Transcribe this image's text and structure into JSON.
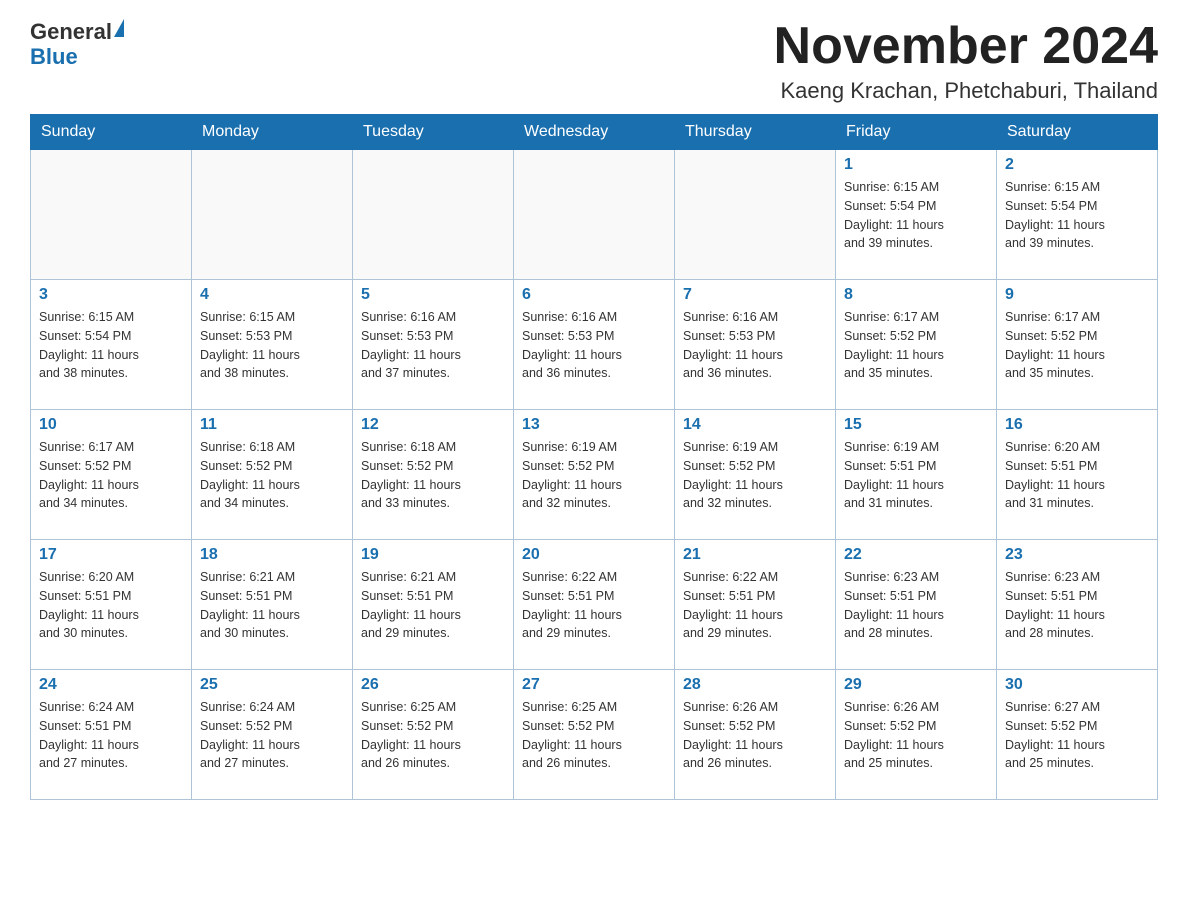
{
  "header": {
    "logo": {
      "line1": "General",
      "line2": "Blue"
    },
    "month_title": "November 2024",
    "location": "Kaeng Krachan, Phetchaburi, Thailand"
  },
  "days_of_week": [
    "Sunday",
    "Monday",
    "Tuesday",
    "Wednesday",
    "Thursday",
    "Friday",
    "Saturday"
  ],
  "weeks": [
    {
      "days": [
        {
          "number": "",
          "info": ""
        },
        {
          "number": "",
          "info": ""
        },
        {
          "number": "",
          "info": ""
        },
        {
          "number": "",
          "info": ""
        },
        {
          "number": "",
          "info": ""
        },
        {
          "number": "1",
          "info": "Sunrise: 6:15 AM\nSunset: 5:54 PM\nDaylight: 11 hours\nand 39 minutes."
        },
        {
          "number": "2",
          "info": "Sunrise: 6:15 AM\nSunset: 5:54 PM\nDaylight: 11 hours\nand 39 minutes."
        }
      ]
    },
    {
      "days": [
        {
          "number": "3",
          "info": "Sunrise: 6:15 AM\nSunset: 5:54 PM\nDaylight: 11 hours\nand 38 minutes."
        },
        {
          "number": "4",
          "info": "Sunrise: 6:15 AM\nSunset: 5:53 PM\nDaylight: 11 hours\nand 38 minutes."
        },
        {
          "number": "5",
          "info": "Sunrise: 6:16 AM\nSunset: 5:53 PM\nDaylight: 11 hours\nand 37 minutes."
        },
        {
          "number": "6",
          "info": "Sunrise: 6:16 AM\nSunset: 5:53 PM\nDaylight: 11 hours\nand 36 minutes."
        },
        {
          "number": "7",
          "info": "Sunrise: 6:16 AM\nSunset: 5:53 PM\nDaylight: 11 hours\nand 36 minutes."
        },
        {
          "number": "8",
          "info": "Sunrise: 6:17 AM\nSunset: 5:52 PM\nDaylight: 11 hours\nand 35 minutes."
        },
        {
          "number": "9",
          "info": "Sunrise: 6:17 AM\nSunset: 5:52 PM\nDaylight: 11 hours\nand 35 minutes."
        }
      ]
    },
    {
      "days": [
        {
          "number": "10",
          "info": "Sunrise: 6:17 AM\nSunset: 5:52 PM\nDaylight: 11 hours\nand 34 minutes."
        },
        {
          "number": "11",
          "info": "Sunrise: 6:18 AM\nSunset: 5:52 PM\nDaylight: 11 hours\nand 34 minutes."
        },
        {
          "number": "12",
          "info": "Sunrise: 6:18 AM\nSunset: 5:52 PM\nDaylight: 11 hours\nand 33 minutes."
        },
        {
          "number": "13",
          "info": "Sunrise: 6:19 AM\nSunset: 5:52 PM\nDaylight: 11 hours\nand 32 minutes."
        },
        {
          "number": "14",
          "info": "Sunrise: 6:19 AM\nSunset: 5:52 PM\nDaylight: 11 hours\nand 32 minutes."
        },
        {
          "number": "15",
          "info": "Sunrise: 6:19 AM\nSunset: 5:51 PM\nDaylight: 11 hours\nand 31 minutes."
        },
        {
          "number": "16",
          "info": "Sunrise: 6:20 AM\nSunset: 5:51 PM\nDaylight: 11 hours\nand 31 minutes."
        }
      ]
    },
    {
      "days": [
        {
          "number": "17",
          "info": "Sunrise: 6:20 AM\nSunset: 5:51 PM\nDaylight: 11 hours\nand 30 minutes."
        },
        {
          "number": "18",
          "info": "Sunrise: 6:21 AM\nSunset: 5:51 PM\nDaylight: 11 hours\nand 30 minutes."
        },
        {
          "number": "19",
          "info": "Sunrise: 6:21 AM\nSunset: 5:51 PM\nDaylight: 11 hours\nand 29 minutes."
        },
        {
          "number": "20",
          "info": "Sunrise: 6:22 AM\nSunset: 5:51 PM\nDaylight: 11 hours\nand 29 minutes."
        },
        {
          "number": "21",
          "info": "Sunrise: 6:22 AM\nSunset: 5:51 PM\nDaylight: 11 hours\nand 29 minutes."
        },
        {
          "number": "22",
          "info": "Sunrise: 6:23 AM\nSunset: 5:51 PM\nDaylight: 11 hours\nand 28 minutes."
        },
        {
          "number": "23",
          "info": "Sunrise: 6:23 AM\nSunset: 5:51 PM\nDaylight: 11 hours\nand 28 minutes."
        }
      ]
    },
    {
      "days": [
        {
          "number": "24",
          "info": "Sunrise: 6:24 AM\nSunset: 5:51 PM\nDaylight: 11 hours\nand 27 minutes."
        },
        {
          "number": "25",
          "info": "Sunrise: 6:24 AM\nSunset: 5:52 PM\nDaylight: 11 hours\nand 27 minutes."
        },
        {
          "number": "26",
          "info": "Sunrise: 6:25 AM\nSunset: 5:52 PM\nDaylight: 11 hours\nand 26 minutes."
        },
        {
          "number": "27",
          "info": "Sunrise: 6:25 AM\nSunset: 5:52 PM\nDaylight: 11 hours\nand 26 minutes."
        },
        {
          "number": "28",
          "info": "Sunrise: 6:26 AM\nSunset: 5:52 PM\nDaylight: 11 hours\nand 26 minutes."
        },
        {
          "number": "29",
          "info": "Sunrise: 6:26 AM\nSunset: 5:52 PM\nDaylight: 11 hours\nand 25 minutes."
        },
        {
          "number": "30",
          "info": "Sunrise: 6:27 AM\nSunset: 5:52 PM\nDaylight: 11 hours\nand 25 minutes."
        }
      ]
    }
  ]
}
